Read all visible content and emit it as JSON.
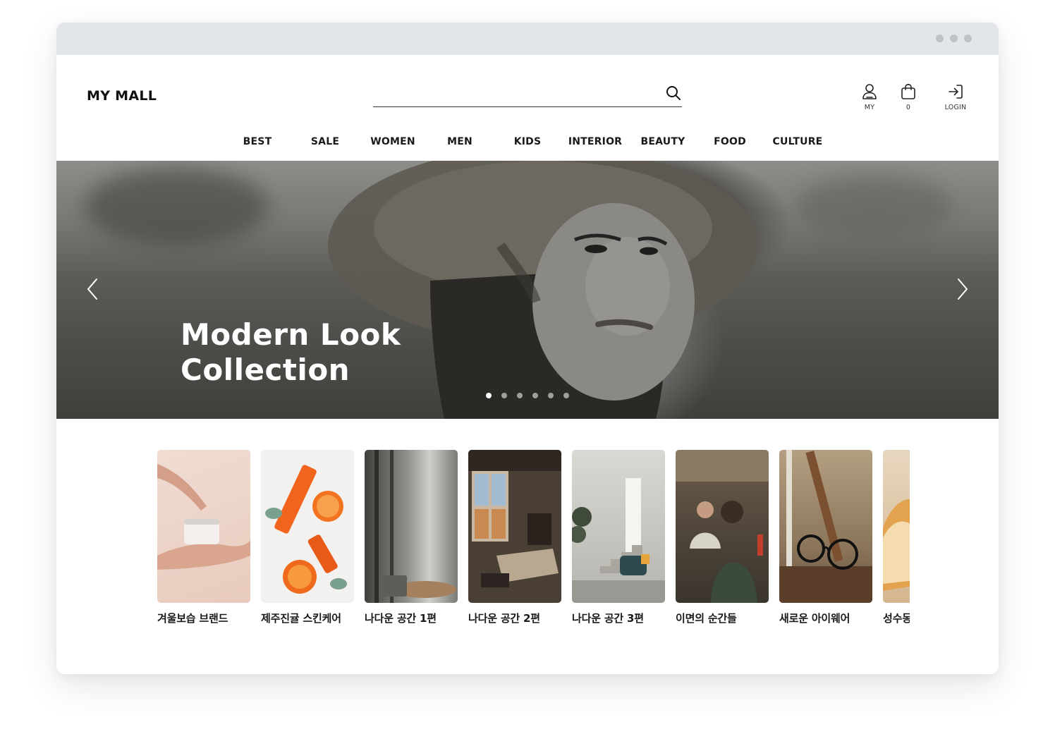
{
  "header": {
    "logo": "MY MALL",
    "search": {
      "value": "",
      "placeholder": ""
    },
    "icons": [
      {
        "name": "user-icon",
        "label": "MY"
      },
      {
        "name": "shopping-bag-icon",
        "label": "0"
      },
      {
        "name": "login-icon",
        "label": "LOGIN"
      }
    ]
  },
  "nav": [
    "BEST",
    "SALE",
    "WOMEN",
    "MEN",
    "KIDS",
    "INTERIOR",
    "BEAUTY",
    "FOOD",
    "CULTURE"
  ],
  "hero": {
    "title_line1": "Modern Look",
    "title_line2": "Collection",
    "slide_count": 6,
    "active_slide": 1,
    "prev_icon": "chevron-left-icon",
    "next_icon": "chevron-right-icon"
  },
  "cards": [
    {
      "label": "겨울보습 브랜드"
    },
    {
      "label": "제주진귤 스킨케어"
    },
    {
      "label": "나다운 공간 1편"
    },
    {
      "label": "나다운 공간 2편"
    },
    {
      "label": "나다운 공간 3편"
    },
    {
      "label": "이면의 순간들"
    },
    {
      "label": "새로운 아이웨어"
    },
    {
      "label": "성수동"
    }
  ]
}
